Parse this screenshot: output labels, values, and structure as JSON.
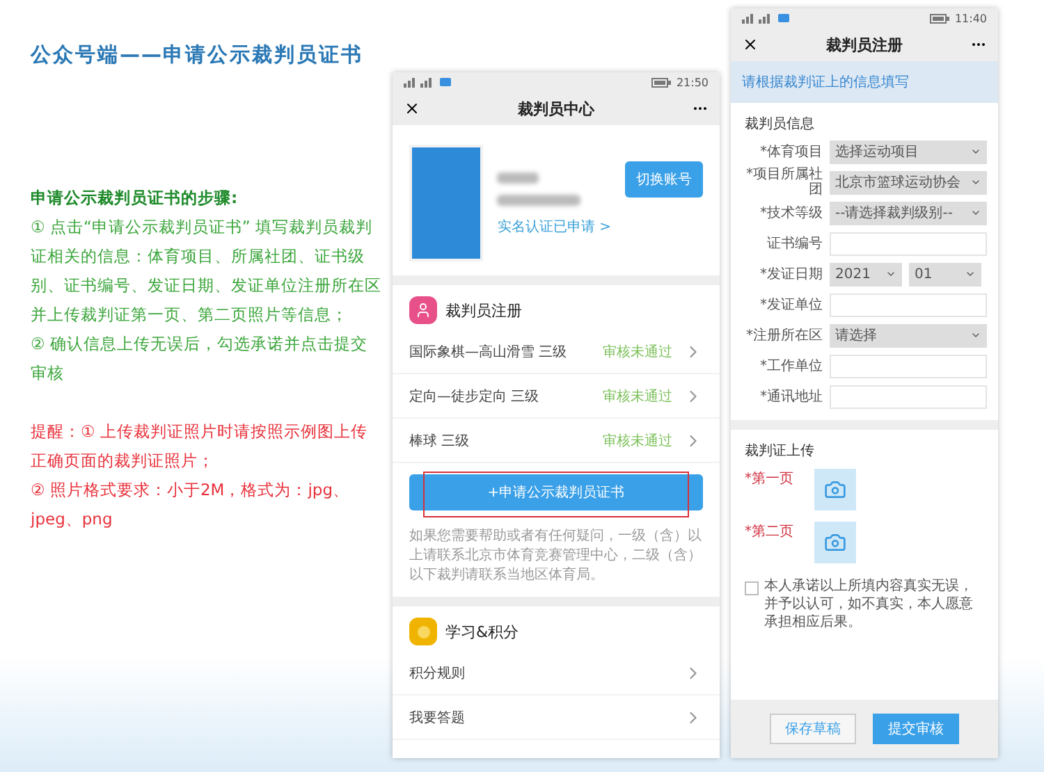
{
  "title": "公众号端——申请公示裁判员证书",
  "instructions": {
    "heading": "申请公示裁判员证书的步骤:",
    "steps": [
      "① 点击“申请公示裁判员证书” 填写裁判员裁判证相关的信息：体育项目、所属社团、证书级别、证书编号、发证日期、发证单位注册所在区并上传裁判证第一页、第二页照片等信息；",
      "② 确认信息上传无误后，勾选承诺并点击提交审核"
    ],
    "reminders": [
      "提醒：① 上传裁判证照片时请按照示例图上传正确页面的裁判证照片；",
      "② 照片格式要求：小于2M，格式为：jpg、jpeg、png"
    ]
  },
  "phone_center": {
    "status_time": "21:50",
    "title": "裁判员中心",
    "profile": {
      "switch_button": "切换账号",
      "verification_link": "实名认证已申请 >"
    },
    "registration": {
      "title": "裁判员注册",
      "rows": [
        {
          "name": "国际象棋—高山滑雪  三级",
          "status": "审核未通过"
        },
        {
          "name": "定向—徒步定向  三级",
          "status": "审核未通过"
        },
        {
          "name": "棒球  三级",
          "status": "审核未通过"
        }
      ]
    },
    "apply_button": {
      "label": "+申请公示裁判员证书",
      "highlighted": true
    },
    "note": "如果您需要帮助或者有任何疑问，一级（含）以上请联系北京市体育竞赛管理中心，二级（含）以下裁判请联系当地区体育局。",
    "study": {
      "title": "学习&积分",
      "rows": [
        "积分规则",
        "我要答题"
      ]
    }
  },
  "phone_register": {
    "status_time": "11:40",
    "title": "裁判员注册",
    "banner": "请根据裁判证上的信息填写",
    "info_title": "裁判员信息",
    "fields": [
      {
        "kind": "select",
        "label": "*体育项目",
        "values": [
          "选择运动项目"
        ]
      },
      {
        "kind": "select",
        "label": "*项目所属社团",
        "values": [
          "北京市篮球运动协会"
        ]
      },
      {
        "kind": "select",
        "label": "*技术等级",
        "values": [
          "--请选择裁判级别--"
        ]
      },
      {
        "kind": "input",
        "label": "证书编号"
      },
      {
        "kind": "date",
        "label": "*发证日期",
        "values": [
          "2021",
          "01"
        ]
      },
      {
        "kind": "input",
        "label": "*发证单位"
      },
      {
        "kind": "select",
        "label": "*注册所在区",
        "values": [
          "请选择"
        ]
      },
      {
        "kind": "input",
        "label": "*工作单位"
      },
      {
        "kind": "input",
        "label": "*通讯地址"
      }
    ],
    "upload_title": "裁判证上传",
    "uploads": [
      "*第一页",
      "*第二页"
    ],
    "pledge": {
      "checked": false,
      "text": "本人承诺以上所填内容真实无误，并予以认可，如不真实，本人愿意承担相应后果。"
    },
    "buttons": [
      {
        "label": "保存草稿",
        "primary": false
      },
      {
        "label": "提交审核",
        "primary": true
      }
    ]
  }
}
